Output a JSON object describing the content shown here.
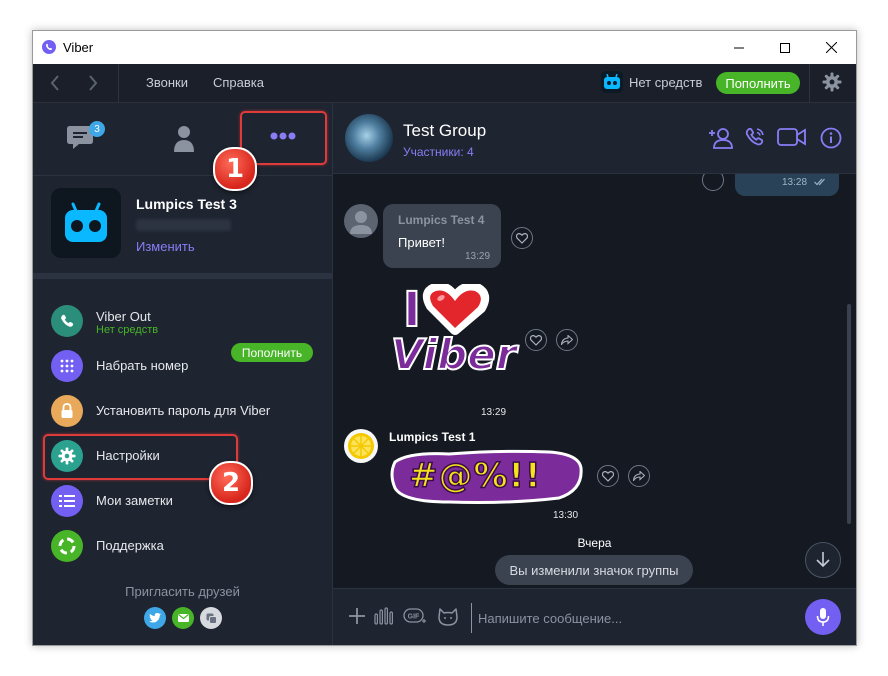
{
  "window": {
    "title": "Viber",
    "controls": [
      "minimize",
      "maximize",
      "close"
    ]
  },
  "toolbar": {
    "menu": [
      "Звонки",
      "Справка"
    ],
    "balance": "Нет средств",
    "topup_label": "Пополнить"
  },
  "sidebar": {
    "chat_badge": "3",
    "profile": {
      "name": "Lumpics Test 3",
      "edit_label": "Изменить"
    },
    "menu": [
      {
        "label": "Viber Out",
        "sub": "Нет средств",
        "icon": "phone-icon",
        "color": "#2b8e7a"
      },
      {
        "label": "Набрать номер",
        "icon": "dialpad-icon",
        "color": "#7360f2"
      },
      {
        "label": "Установить пароль для Viber",
        "icon": "lock-icon",
        "color": "#e8a95a"
      },
      {
        "label": "Настройки",
        "icon": "gear-icon",
        "color": "#2ba28f"
      },
      {
        "label": "Мои заметки",
        "icon": "notes-icon",
        "color": "#7360f2"
      },
      {
        "label": "Поддержка",
        "icon": "lifebuoy-icon",
        "color": "#47b527"
      }
    ],
    "topup_label": "Пополнить",
    "invite_label": "Пригласить друзей",
    "social": [
      "twitter-icon",
      "email-icon",
      "copy-icon"
    ]
  },
  "annotations": {
    "marker1": "1",
    "marker2": "2"
  },
  "chat": {
    "group_name": "Test Group",
    "participants": "Участники: 4",
    "messages": [
      {
        "type": "outgoing",
        "time": "13:28"
      },
      {
        "type": "text",
        "sender": "Lumpics Test 4",
        "text": "Привет!",
        "time": "13:29"
      },
      {
        "type": "sticker",
        "sticker_line1": "I",
        "sticker_line2": "Viber",
        "time": "13:29"
      },
      {
        "type": "sticker",
        "sender": "Lumpics Test 1",
        "sticker_text": "#@%!!",
        "time": "13:30"
      }
    ],
    "date_separator": "Вчера",
    "system_message": "Вы изменили значок группы",
    "composer_placeholder": "Напишите сообщение...",
    "gif_label": "GIF"
  },
  "colors": {
    "accent": "#7360f2",
    "green": "#47b527",
    "highlight": "#e03b3b"
  }
}
